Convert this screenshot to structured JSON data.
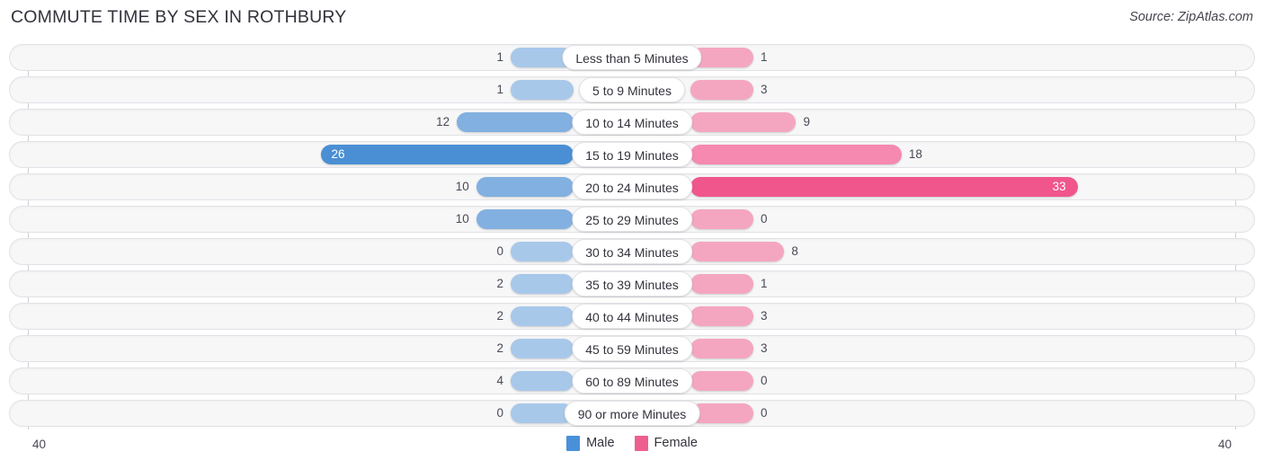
{
  "header": {
    "title": "COMMUTE TIME BY SEX IN ROTHBURY",
    "source": "Source: ZipAtlas.com"
  },
  "axis": {
    "left_tick": "40",
    "right_tick": "40"
  },
  "legend": {
    "items": [
      {
        "label": "Male",
        "color": "#4a90d9"
      },
      {
        "label": "Female",
        "color": "#ee5f8f"
      }
    ]
  },
  "colors": {
    "male_light": "#a8c8ea",
    "male_mid": "#82b0e0",
    "male_strong": "#4a8fd4",
    "female_light": "#f4a6c0",
    "female_mid": "#f589af",
    "female_strong": "#f0568c",
    "track_fill": "#f7f7f8",
    "track_border": "#e2e2e6"
  },
  "chart_data": {
    "type": "bar",
    "subtype": "diverging-bidirectional",
    "title": "COMMUTE TIME BY SEX IN ROTHBURY",
    "xlabel": "",
    "ylabel": "",
    "xlim": [
      40,
      40
    ],
    "axis_max": 40,
    "grid": false,
    "legend_position": "bottom-center",
    "categories": [
      "Less than 5 Minutes",
      "5 to 9 Minutes",
      "10 to 14 Minutes",
      "15 to 19 Minutes",
      "20 to 24 Minutes",
      "25 to 29 Minutes",
      "30 to 34 Minutes",
      "35 to 39 Minutes",
      "40 to 44 Minutes",
      "45 to 59 Minutes",
      "60 to 89 Minutes",
      "90 or more Minutes"
    ],
    "series": [
      {
        "name": "Male",
        "color": "#4a90d9",
        "direction": "left",
        "values": [
          1,
          1,
          12,
          26,
          10,
          10,
          0,
          2,
          2,
          2,
          4,
          0
        ]
      },
      {
        "name": "Female",
        "color": "#ee5f8f",
        "direction": "right",
        "values": [
          1,
          3,
          9,
          18,
          33,
          0,
          8,
          1,
          3,
          3,
          0,
          0
        ]
      }
    ]
  }
}
